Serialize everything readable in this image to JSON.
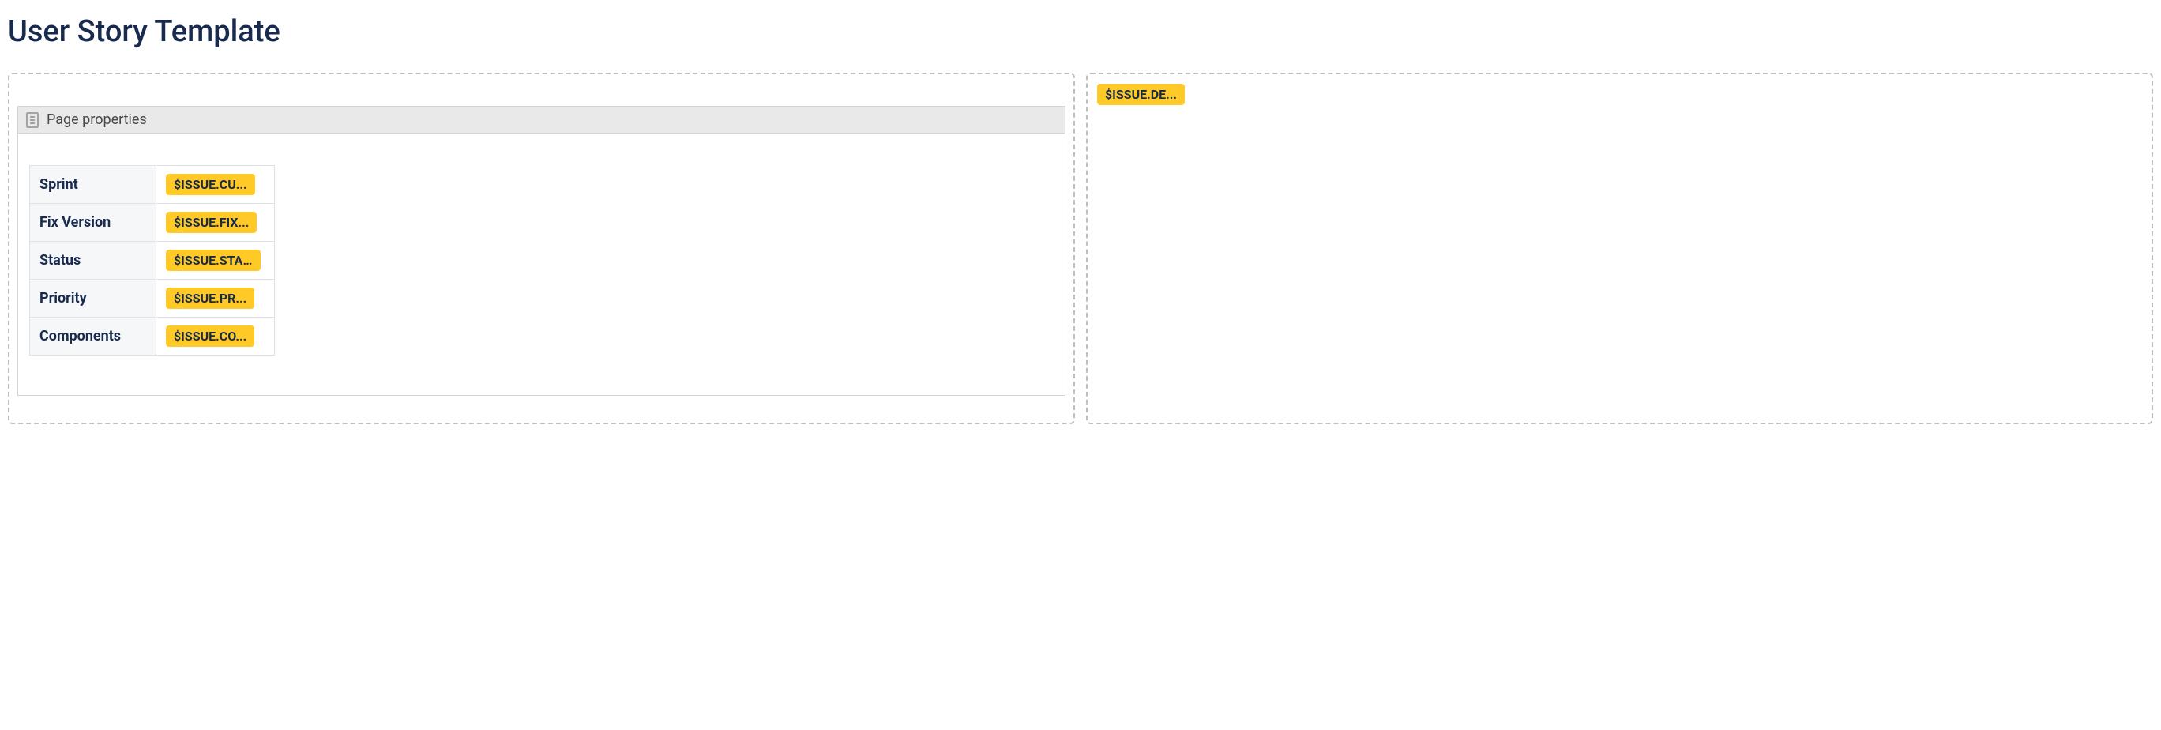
{
  "title": "User Story Template",
  "leftCell": {
    "macro": {
      "title": "Page properties",
      "rows": [
        {
          "label": "Sprint",
          "placeholder": "$ISSUE.CU..."
        },
        {
          "label": "Fix Version",
          "placeholder": "$ISSUE.FIX..."
        },
        {
          "label": "Status",
          "placeholder": "$ISSUE.STA..."
        },
        {
          "label": "Priority",
          "placeholder": "$ISSUE.PR..."
        },
        {
          "label": "Components",
          "placeholder": "$ISSUE.CO..."
        }
      ]
    }
  },
  "rightCell": {
    "placeholder": "$ISSUE.DE..."
  }
}
